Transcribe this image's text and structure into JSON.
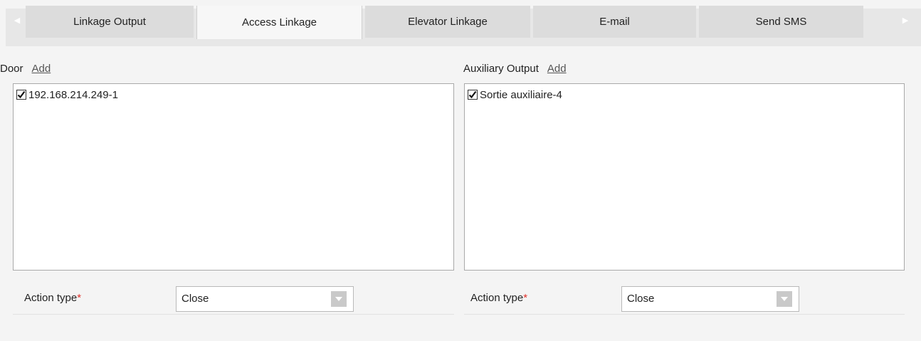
{
  "tabs": [
    {
      "label": "Linkage Output",
      "active": false
    },
    {
      "label": "Access Linkage",
      "active": true
    },
    {
      "label": "Elevator Linkage",
      "active": false
    },
    {
      "label": "E-mail",
      "active": false
    },
    {
      "label": "Send SMS",
      "active": false
    }
  ],
  "door": {
    "title": "Door",
    "add_label": "Add",
    "items": [
      {
        "label": "192.168.214.249-1",
        "checked": true
      }
    ],
    "action_label": "Action type",
    "required_mark": "*",
    "action_value": "Close"
  },
  "auxiliary": {
    "title": "Auxiliary Output",
    "add_label": "Add",
    "items": [
      {
        "label": "Sortie auxiliaire-4",
        "checked": true
      }
    ],
    "action_label": "Action type",
    "required_mark": "*",
    "action_value": "Close"
  },
  "icons": {
    "scroll_left": "chevron-left-icon",
    "scroll_right": "chevron-right-icon",
    "checkbox": "checkmark-icon",
    "dropdown": "chevron-down-icon"
  },
  "colors": {
    "required": "#e0322b",
    "tab_active": "#f7f7f7",
    "tab_inactive": "#dcdcdc"
  }
}
